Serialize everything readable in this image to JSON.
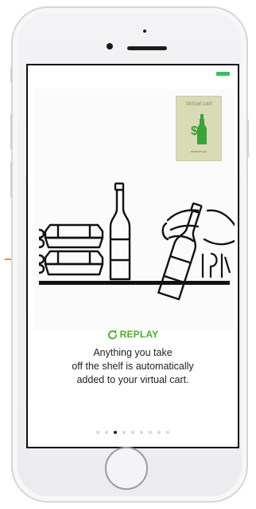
{
  "tutorial": {
    "replay_label": "REPLAY",
    "caption_line1": "Anything you take",
    "caption_line2": "off the shelf is automatically",
    "caption_line3": "added to your virtual cart.",
    "page_index": 2,
    "page_count": 9
  },
  "illustration": {
    "ticket_label": "Virtual cart",
    "ticket_fineprint": "amazon go"
  },
  "colors": {
    "accent": "#4caf2b",
    "battery": "#37c35f",
    "ticket_bg": "#d9dbb6",
    "ticket_bottle": "#3ea23a"
  },
  "icons": {
    "replay": "circular-arrow-icon"
  }
}
